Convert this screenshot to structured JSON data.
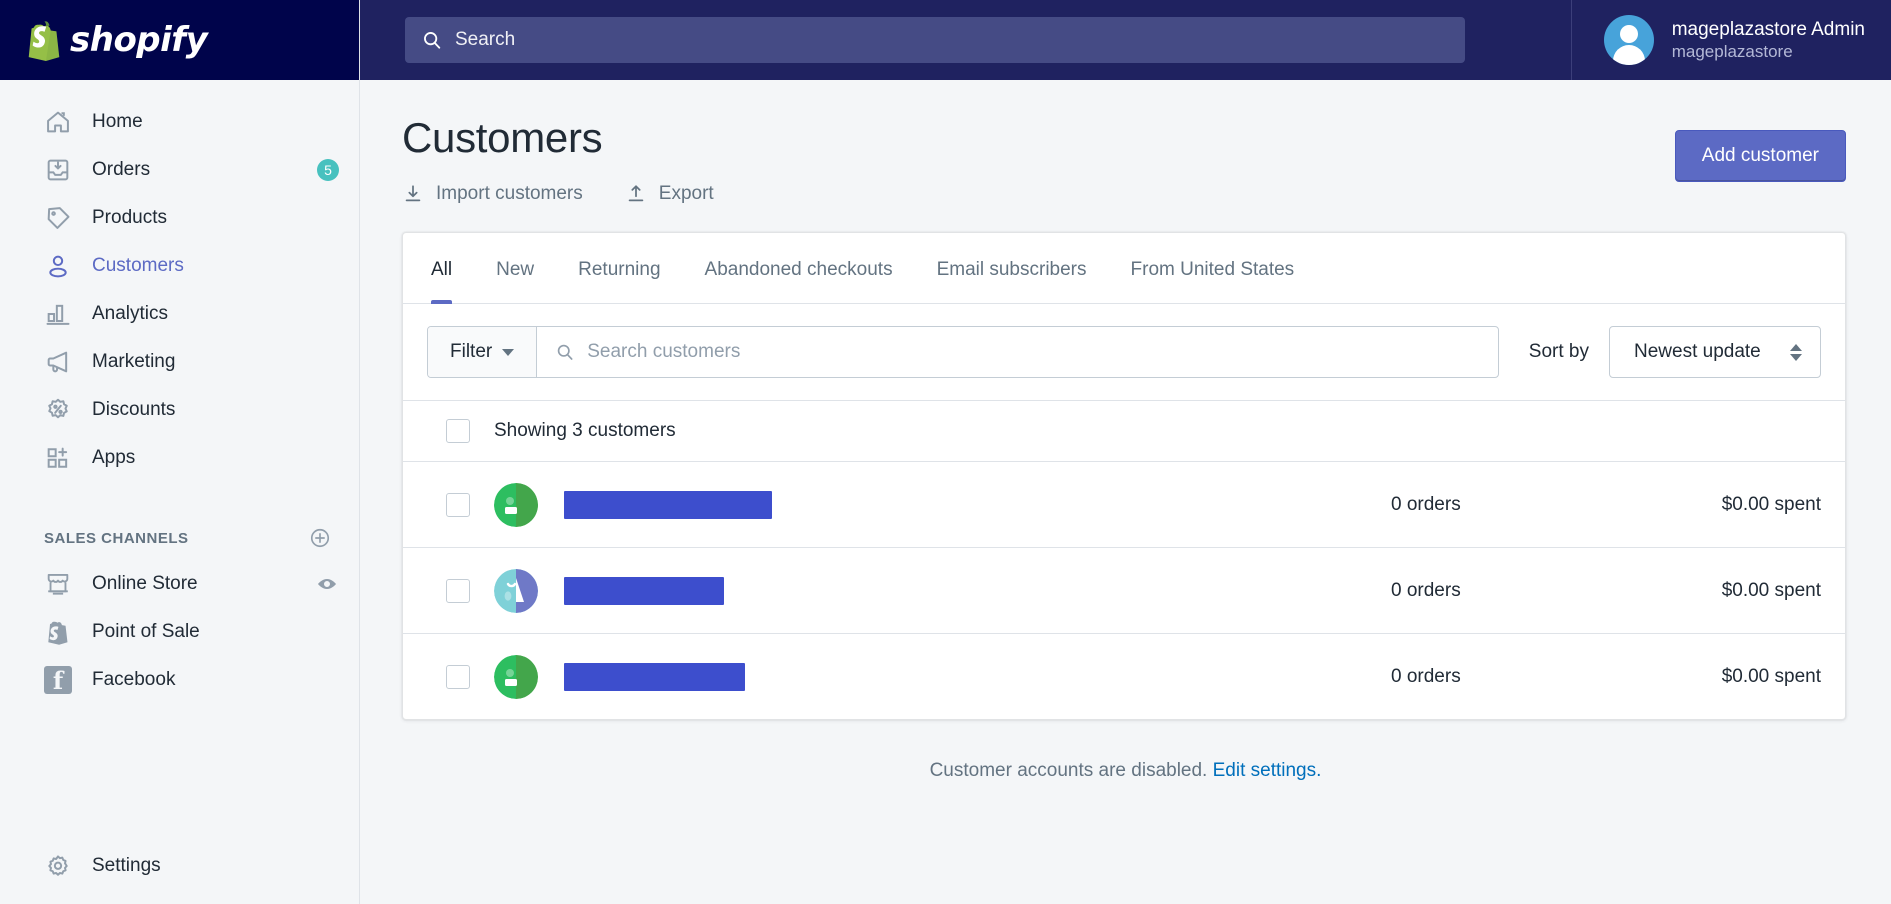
{
  "brand": {
    "name": "shopify",
    "logo_icon": "shopify-bag-logo",
    "bar_color": "#00044b"
  },
  "topbar": {
    "search": {
      "placeholder": "Search",
      "value": "",
      "icon": "search-icon"
    },
    "user": {
      "name": "mageplazastore Admin",
      "store": "mageplazastore",
      "avatar_icon": "user-avatar"
    }
  },
  "sidebar": {
    "items": [
      {
        "label": "Home",
        "icon": "home-icon",
        "badge": ""
      },
      {
        "label": "Orders",
        "icon": "orders-inbox-icon",
        "badge": "5"
      },
      {
        "label": "Products",
        "icon": "tag-icon",
        "badge": ""
      },
      {
        "label": "Customers",
        "icon": "person-icon",
        "badge": "",
        "active": true
      },
      {
        "label": "Analytics",
        "icon": "bar-chart-icon",
        "badge": ""
      },
      {
        "label": "Marketing",
        "icon": "megaphone-icon",
        "badge": ""
      },
      {
        "label": "Discounts",
        "icon": "discount-percent-icon",
        "badge": ""
      },
      {
        "label": "Apps",
        "icon": "apps-grid-plus-icon",
        "badge": ""
      }
    ],
    "sales_channels": {
      "title": "SALES CHANNELS",
      "add_icon": "plus-circle-icon",
      "items": [
        {
          "label": "Online Store",
          "icon": "storefront-icon",
          "action_icon": "eye-icon"
        },
        {
          "label": "Point of Sale",
          "icon": "shopify-pos-icon",
          "action_icon": ""
        },
        {
          "label": "Facebook",
          "icon": "facebook-icon",
          "action_icon": ""
        }
      ]
    },
    "settings": {
      "label": "Settings",
      "icon": "gear-icon"
    }
  },
  "page": {
    "title": "Customers",
    "actions": [
      {
        "label": "Import customers",
        "icon": "import-download-icon"
      },
      {
        "label": "Export",
        "icon": "export-upload-icon"
      }
    ],
    "primary_button": {
      "label": "Add customer",
      "color": "#5c6ac4"
    }
  },
  "tabs": [
    {
      "label": "All",
      "active": true
    },
    {
      "label": "New",
      "active": false
    },
    {
      "label": "Returning",
      "active": false
    },
    {
      "label": "Abandoned checkouts",
      "active": false
    },
    {
      "label": "Email subscribers",
      "active": false
    },
    {
      "label": "From United States",
      "active": false
    }
  ],
  "toolbar": {
    "filter_label": "Filter",
    "filter_caret_icon": "chevron-down-icon",
    "search_placeholder": "Search customers",
    "search_value": "",
    "search_icon": "search-icon",
    "sort_label": "Sort by",
    "sort_value": "Newest update",
    "sort_icon": "sort-updown-icon",
    "sort_options": [
      "Newest update"
    ]
  },
  "list": {
    "select_all_checkbox": "unchecked",
    "showing_text": "Showing 3 customers",
    "rows": [
      {
        "name": "",
        "name_redacted": true,
        "redact_width": 208,
        "avatar_icon": "evernote-green-avatar",
        "orders": "0 orders",
        "spent": "$0.00 spent",
        "checkbox": "unchecked"
      },
      {
        "name": "",
        "name_redacted": true,
        "redact_width": 160,
        "avatar_icon": "teal-purple-avatar",
        "orders": "0 orders",
        "spent": "$0.00 spent",
        "checkbox": "unchecked"
      },
      {
        "name": "",
        "name_redacted": true,
        "redact_width": 181,
        "avatar_icon": "evernote-green-avatar",
        "orders": "0 orders",
        "spent": "$0.00 spent",
        "checkbox": "unchecked"
      }
    ]
  },
  "footer": {
    "text": "Customer accounts are disabled.",
    "link": "Edit settings."
  }
}
